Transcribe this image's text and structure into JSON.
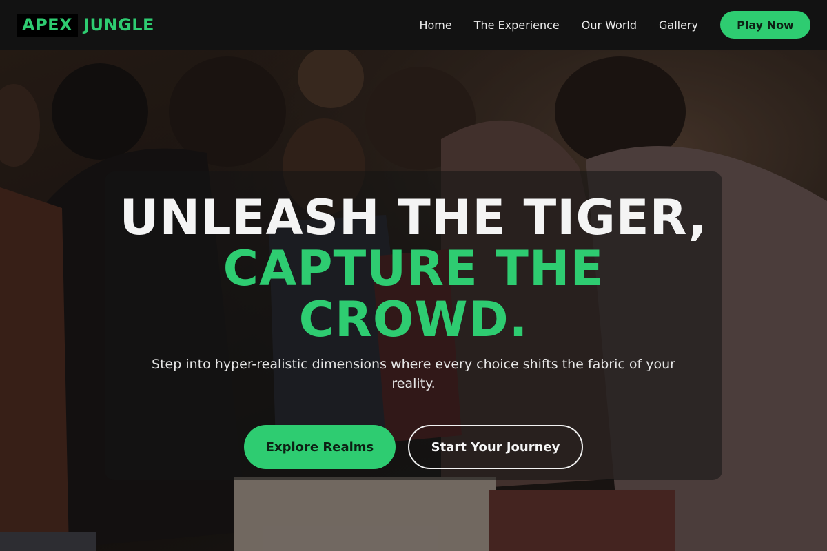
{
  "brand": {
    "word1": "APEX",
    "word2": "JUNGLE",
    "accent": "#2ecc71"
  },
  "nav": {
    "links": [
      "Home",
      "The Experience",
      "Our World",
      "Gallery"
    ],
    "cta": "Play Now"
  },
  "hero": {
    "headline_line1": "UNLEASH THE TIGER,",
    "headline_line2": "CAPTURE THE",
    "headline_line3": "CROWD.",
    "subtext": "Step into hyper-realistic dimensions where every choice shifts the fabric of your reality.",
    "primary_cta": "Explore Realms",
    "secondary_cta": "Start Your Journey"
  }
}
